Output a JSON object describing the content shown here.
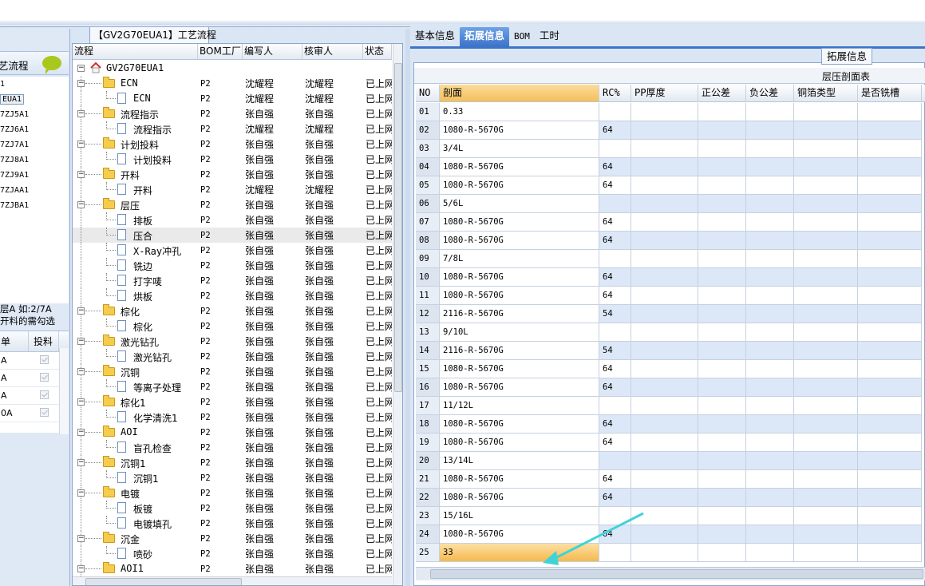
{
  "left_panel": {
    "title": "艺流程",
    "items": [
      "1",
      "EUA1",
      "7ZJ5A1",
      "7ZJ6A1",
      "7ZJ7A1",
      "7ZJ8A1",
      "7ZJ9A1",
      "7ZJAA1",
      "7ZJBA1"
    ],
    "selected_index": 1,
    "note_line1": "层A 如:2/7A",
    "note_line2": "开料的需勾选",
    "grid_headers": [
      "单",
      "投料"
    ],
    "grid_rows": [
      "A",
      "A",
      "A",
      "0A"
    ]
  },
  "tree_panel": {
    "tab_label": "【GV2G70EUA1】工艺流程",
    "headers": [
      "流程",
      "BOM工厂",
      "编写人",
      "核审人",
      "状态"
    ],
    "root": "GV2G70EUA1",
    "rows": [
      {
        "name": "ECN",
        "type": "folder",
        "bom": "P2",
        "writer": "沈耀程",
        "reviewer": "沈耀程",
        "status": "已上网"
      },
      {
        "name": "ECN",
        "type": "doc",
        "bom": "P2",
        "writer": "沈耀程",
        "reviewer": "沈耀程",
        "status": "已上网"
      },
      {
        "name": "流程指示",
        "type": "folder",
        "bom": "P2",
        "writer": "张自强",
        "reviewer": "张自强",
        "status": "已上网"
      },
      {
        "name": "流程指示",
        "type": "doc",
        "bom": "P2",
        "writer": "沈耀程",
        "reviewer": "沈耀程",
        "status": "已上网"
      },
      {
        "name": "计划投料",
        "type": "folder",
        "bom": "P2",
        "writer": "张自强",
        "reviewer": "张自强",
        "status": "已上网"
      },
      {
        "name": "计划投料",
        "type": "doc",
        "bom": "P2",
        "writer": "张自强",
        "reviewer": "张自强",
        "status": "已上网"
      },
      {
        "name": "开料",
        "type": "folder",
        "bom": "P2",
        "writer": "张自强",
        "reviewer": "张自强",
        "status": "已上网"
      },
      {
        "name": "开料",
        "type": "doc",
        "bom": "P2",
        "writer": "沈耀程",
        "reviewer": "沈耀程",
        "status": "已上网"
      },
      {
        "name": "层压",
        "type": "folder",
        "bom": "P2",
        "writer": "张自强",
        "reviewer": "张自强",
        "status": "已上网"
      },
      {
        "name": "排板",
        "type": "doc",
        "bom": "P2",
        "writer": "张自强",
        "reviewer": "张自强",
        "status": "已上网"
      },
      {
        "name": "压合",
        "type": "doc",
        "bom": "P2",
        "writer": "张自强",
        "reviewer": "张自强",
        "status": "已上网",
        "highlight": true
      },
      {
        "name": "X-Ray冲孔",
        "type": "doc",
        "bom": "P2",
        "writer": "张自强",
        "reviewer": "张自强",
        "status": "已上网"
      },
      {
        "name": "铣边",
        "type": "doc",
        "bom": "P2",
        "writer": "张自强",
        "reviewer": "张自强",
        "status": "已上网"
      },
      {
        "name": "打字唛",
        "type": "doc",
        "bom": "P2",
        "writer": "张自强",
        "reviewer": "张自强",
        "status": "已上网"
      },
      {
        "name": "烘板",
        "type": "doc",
        "bom": "P2",
        "writer": "张自强",
        "reviewer": "张自强",
        "status": "已上网"
      },
      {
        "name": "棕化",
        "type": "folder",
        "bom": "P2",
        "writer": "张自强",
        "reviewer": "张自强",
        "status": "已上网"
      },
      {
        "name": "棕化",
        "type": "doc",
        "bom": "P2",
        "writer": "张自强",
        "reviewer": "张自强",
        "status": "已上网"
      },
      {
        "name": "激光钻孔",
        "type": "folder",
        "bom": "P2",
        "writer": "张自强",
        "reviewer": "张自强",
        "status": "已上网"
      },
      {
        "name": "激光钻孔",
        "type": "doc",
        "bom": "P2",
        "writer": "张自强",
        "reviewer": "张自强",
        "status": "已上网"
      },
      {
        "name": "沉铜",
        "type": "folder",
        "bom": "P2",
        "writer": "张自强",
        "reviewer": "张自强",
        "status": "已上网"
      },
      {
        "name": "等离子处理",
        "type": "doc",
        "bom": "P2",
        "writer": "张自强",
        "reviewer": "张自强",
        "status": "已上网"
      },
      {
        "name": "棕化1",
        "type": "folder",
        "bom": "P2",
        "writer": "张自强",
        "reviewer": "张自强",
        "status": "已上网"
      },
      {
        "name": "化学清洗1",
        "type": "doc",
        "bom": "P2",
        "writer": "张自强",
        "reviewer": "张自强",
        "status": "已上网"
      },
      {
        "name": "AOI",
        "type": "folder",
        "bom": "P2",
        "writer": "张自强",
        "reviewer": "张自强",
        "status": "已上网"
      },
      {
        "name": "盲孔检查",
        "type": "doc",
        "bom": "P2",
        "writer": "张自强",
        "reviewer": "张自强",
        "status": "已上网"
      },
      {
        "name": "沉铜1",
        "type": "folder",
        "bom": "P2",
        "writer": "张自强",
        "reviewer": "张自强",
        "status": "已上网"
      },
      {
        "name": "沉铜1",
        "type": "doc",
        "bom": "P2",
        "writer": "张自强",
        "reviewer": "张自强",
        "status": "已上网"
      },
      {
        "name": "电镀",
        "type": "folder",
        "bom": "P2",
        "writer": "张自强",
        "reviewer": "张自强",
        "status": "已上网"
      },
      {
        "name": "板镀",
        "type": "doc",
        "bom": "P2",
        "writer": "张自强",
        "reviewer": "张自强",
        "status": "已上网"
      },
      {
        "name": "电镀填孔",
        "type": "doc",
        "bom": "P2",
        "writer": "张自强",
        "reviewer": "张自强",
        "status": "已上网"
      },
      {
        "name": "沉金",
        "type": "folder",
        "bom": "P2",
        "writer": "张自强",
        "reviewer": "张自强",
        "status": "已上网"
      },
      {
        "name": "喷砂",
        "type": "doc",
        "bom": "P2",
        "writer": "张自强",
        "reviewer": "张自强",
        "status": "已上网"
      },
      {
        "name": "AOI1",
        "type": "folder",
        "bom": "P2",
        "writer": "张自强",
        "reviewer": "张自强",
        "status": "已上网"
      }
    ]
  },
  "right_panel": {
    "tabs": [
      "基本信息",
      "拓展信息",
      "BOM",
      "工时"
    ],
    "active_tab": 1,
    "ext_tab_label": "拓展信息",
    "grid_title": "层压剖面表",
    "headers": [
      "NO",
      "剖面",
      "RC%",
      "PP厚度",
      "正公差",
      "负公差",
      "铜箔类型",
      "是否铣槽"
    ],
    "rows": [
      [
        "01",
        "0.33",
        ""
      ],
      [
        "02",
        "1080-R-5670G",
        "64"
      ],
      [
        "03",
        "3/4L",
        ""
      ],
      [
        "04",
        "1080-R-5670G",
        "64"
      ],
      [
        "05",
        "1080-R-5670G",
        "64"
      ],
      [
        "06",
        "5/6L",
        ""
      ],
      [
        "07",
        "1080-R-5670G",
        "64"
      ],
      [
        "08",
        "1080-R-5670G",
        "64"
      ],
      [
        "09",
        "7/8L",
        ""
      ],
      [
        "10",
        "1080-R-5670G",
        "64"
      ],
      [
        "11",
        "1080-R-5670G",
        "64"
      ],
      [
        "12",
        "2116-R-5670G",
        "54"
      ],
      [
        "13",
        "9/10L",
        ""
      ],
      [
        "14",
        "2116-R-5670G",
        "54"
      ],
      [
        "15",
        "1080-R-5670G",
        "64"
      ],
      [
        "16",
        "1080-R-5670G",
        "64"
      ],
      [
        "17",
        "11/12L",
        ""
      ],
      [
        "18",
        "1080-R-5670G",
        "64"
      ],
      [
        "19",
        "1080-R-5670G",
        "64"
      ],
      [
        "20",
        "13/14L",
        ""
      ],
      [
        "21",
        "1080-R-5670G",
        "64"
      ],
      [
        "22",
        "1080-R-5670G",
        "64"
      ],
      [
        "23",
        "15/16L",
        ""
      ],
      [
        "24",
        "1080-R-5670G",
        "64"
      ],
      [
        "25",
        "33",
        ""
      ]
    ],
    "arrow_color": "#3fd3d8"
  }
}
